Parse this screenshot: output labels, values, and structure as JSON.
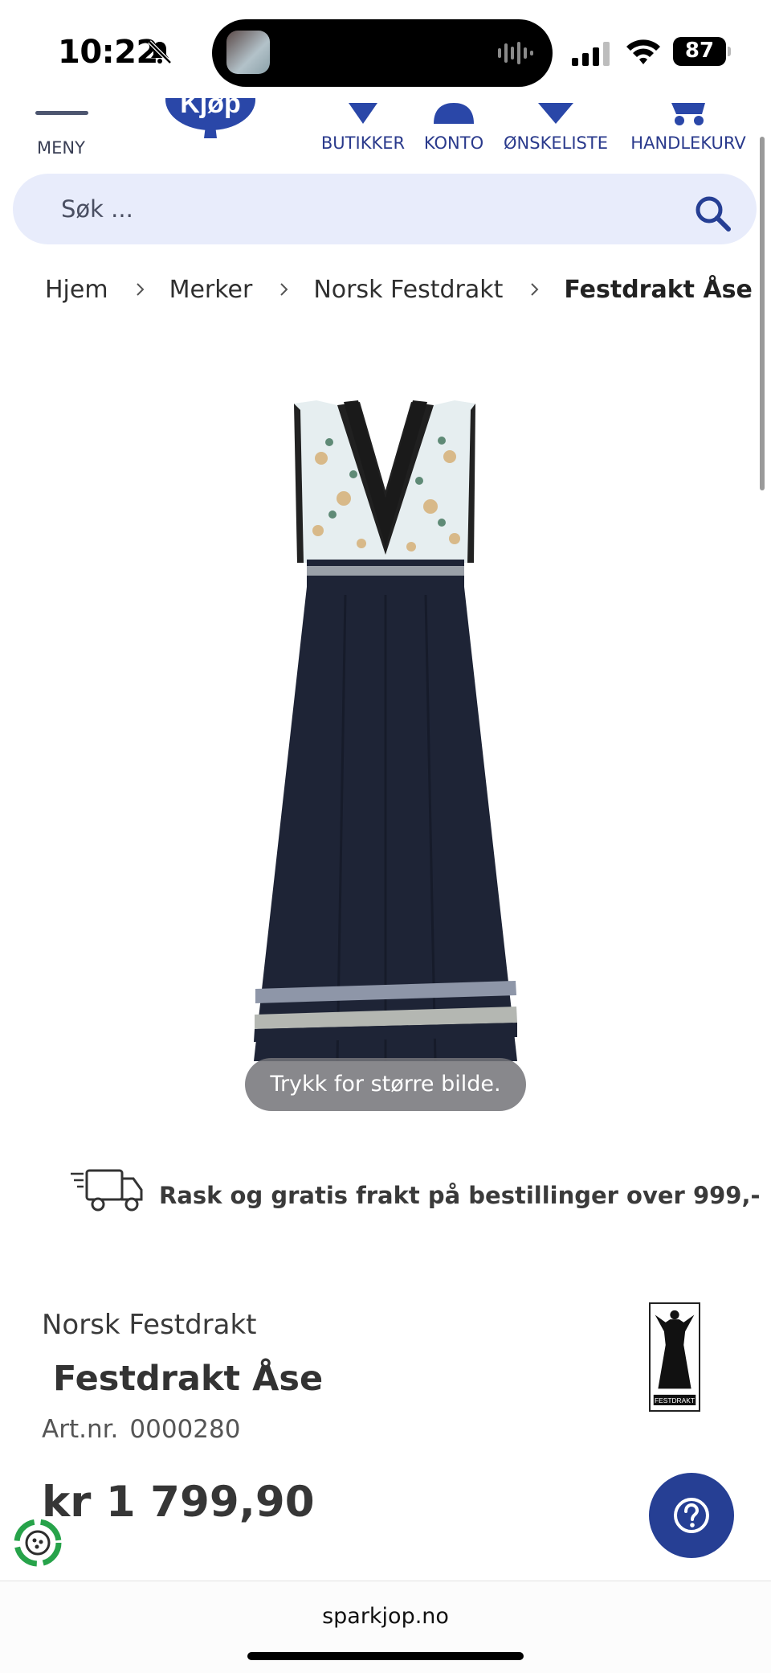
{
  "status_bar": {
    "time": "10:22",
    "battery": "87",
    "icons": [
      "bell-slash-icon",
      "signal-icon",
      "wifi-icon",
      "battery-icon"
    ]
  },
  "header": {
    "menu_label": "MENY",
    "logo_text": "Kjøp",
    "nav": [
      {
        "label": "BUTIKKER",
        "icon": "store-pin-icon"
      },
      {
        "label": "KONTO",
        "icon": "account-icon"
      },
      {
        "label": "ØNSKELISTE",
        "icon": "wishlist-heart-icon"
      },
      {
        "label": "HANDLEKURV",
        "icon": "cart-icon"
      }
    ]
  },
  "search": {
    "placeholder": "Søk ..."
  },
  "breadcrumb": [
    "Hjem",
    "Merker",
    "Norsk Festdrakt",
    "Festdrakt Åse"
  ],
  "image": {
    "tap_hint": "Trykk for større bilde."
  },
  "shipping": {
    "text": "Rask og gratis frakt på bestillinger over 999,-"
  },
  "product": {
    "brand": "Norsk Festdrakt",
    "brand_logo_text": "FESTDRAKT",
    "title": "Festdrakt Åse",
    "art_label": "Art.nr.",
    "art_number": "0000280",
    "price": "kr 1 799,90"
  },
  "browser": {
    "url": "sparkjop.no"
  },
  "colors": {
    "brand_blue": "#263f94",
    "search_bg": "#e8ecfb",
    "dress_navy": "#1e2436"
  }
}
